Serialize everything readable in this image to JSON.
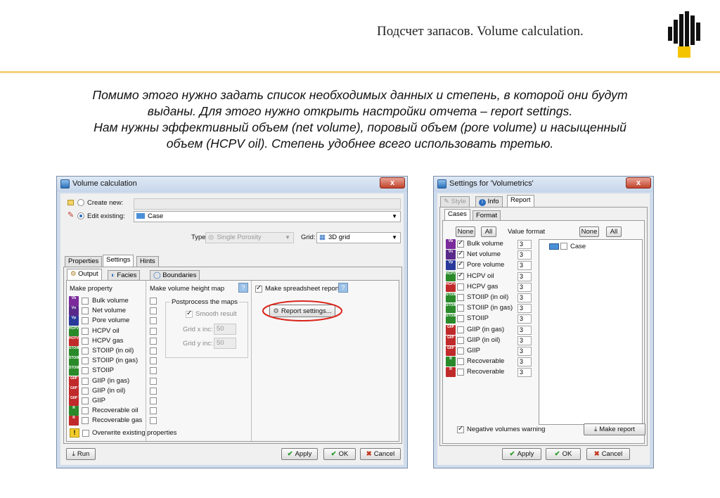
{
  "slide": {
    "title": "Подсчет запасов. Volume calculation.",
    "description_lines": [
      "Помимо этого нужно задать список необходимых данных и степень, в которой они будут",
      "выданы. Для этого нужно открыть настройки отчета – report settings.",
      "Нам нужны эффективный объем (net volume), поровый объем (pore volume) и насыщенный",
      "объем (HCPV oil). Степень удобнее всего использовать третью."
    ]
  },
  "left_window": {
    "title": "Volume calculation",
    "close": "x",
    "create_new_label": "Create new:",
    "edit_existing_label": "Edit existing:",
    "edit_existing_value": "Case",
    "type_label": "Type:",
    "type_value": "Single Porosity",
    "grid_label": "Grid:",
    "grid_value": "3D grid",
    "tabs": [
      "Properties",
      "Settings",
      "Hints"
    ],
    "subtabs": [
      "Output",
      "Facies",
      "Boundaries"
    ],
    "col_make_property": "Make property",
    "col_height_map": "Make volume height map",
    "col_spreadsheet": "Make spreadsheet report",
    "postprocess_title": "Postprocess the maps",
    "smooth_label": "Smooth result",
    "grid_x_label": "Grid x inc:",
    "grid_x_value": "50",
    "grid_y_label": "Grid y inc:",
    "grid_y_value": "50",
    "report_settings_button": "Report settings...",
    "help_icon": "?",
    "properties": [
      {
        "icon": "Vb",
        "label": "Bulk volume",
        "color": "#7a2a9a"
      },
      {
        "icon": "Vn",
        "label": "Net volume",
        "color": "#5a2a8a"
      },
      {
        "icon": "Vp",
        "label": "Pore volume",
        "color": "#2a3a9a"
      },
      {
        "icon": "HCPV",
        "label": "HCPV oil",
        "color": "#2a8a2a"
      },
      {
        "icon": "HCPV",
        "label": "HCPV gas",
        "color": "#c02a2a"
      },
      {
        "icon": "STOIIP",
        "label": "STOIIP (in oil)",
        "color": "#2a8a2a"
      },
      {
        "icon": "STOIIP",
        "label": "STOIIP (in gas)",
        "color": "#2a8a2a"
      },
      {
        "icon": "STOIIP",
        "label": "STOIIP",
        "color": "#2a8a2a"
      },
      {
        "icon": "GIIP",
        "label": "GIIP (in gas)",
        "color": "#c02a2a"
      },
      {
        "icon": "GIIP",
        "label": "GIIP (in oil)",
        "color": "#c02a2a"
      },
      {
        "icon": "GIIP",
        "label": "GIIP",
        "color": "#c02a2a"
      },
      {
        "icon": "R",
        "label": "Recoverable oil",
        "color": "#2a8a2a"
      },
      {
        "icon": "R",
        "label": "Recoverable gas",
        "color": "#c02a2a"
      }
    ],
    "overwrite_label": "Overwrite existing properties",
    "run_button": "Run",
    "apply_button": "Apply",
    "ok_button": "OK",
    "cancel_button": "Cancel"
  },
  "right_window": {
    "title": "Settings for 'Volumetrics'",
    "close": "x",
    "top_tabs": [
      "Style",
      "Info",
      "Report"
    ],
    "sub_tabs": [
      "Cases",
      "Format"
    ],
    "none_button": "None",
    "all_button": "All",
    "value_format_label": "Value format",
    "case_label": "Case",
    "items": [
      {
        "icon": "Vb",
        "label": "Bulk volume",
        "checked": true,
        "format": "3",
        "color": "#7a2a9a"
      },
      {
        "icon": "Vn",
        "label": "Net volume",
        "checked": true,
        "format": "3",
        "color": "#5a2a8a"
      },
      {
        "icon": "Vp",
        "label": "Pore volume",
        "checked": true,
        "format": "3",
        "color": "#2a3a9a"
      },
      {
        "icon": "HCPV",
        "label": "HCPV oil",
        "checked": true,
        "format": "3",
        "color": "#2a8a2a"
      },
      {
        "icon": "HCPV",
        "label": "HCPV gas",
        "checked": false,
        "format": "3",
        "color": "#c02a2a"
      },
      {
        "icon": "STOIIP",
        "label": "STOIIP (in oil)",
        "checked": false,
        "format": "3",
        "color": "#2a8a2a"
      },
      {
        "icon": "STOIIP",
        "label": "STOIIP (in gas)",
        "checked": false,
        "format": "3",
        "color": "#2a8a2a"
      },
      {
        "icon": "STOIIP",
        "label": "STOIIP",
        "checked": false,
        "format": "3",
        "color": "#2a8a2a"
      },
      {
        "icon": "GIIP",
        "label": "GIIP (in gas)",
        "checked": false,
        "format": "3",
        "color": "#c02a2a"
      },
      {
        "icon": "GIIP",
        "label": "GIIP (in oil)",
        "checked": false,
        "format": "3",
        "color": "#c02a2a"
      },
      {
        "icon": "GIIP",
        "label": "GIIP",
        "checked": false,
        "format": "3",
        "color": "#c02a2a"
      },
      {
        "icon": "R",
        "label": "Recoverable",
        "checked": false,
        "format": "3",
        "color": "#2a8a2a"
      },
      {
        "icon": "R",
        "label": "Recoverable",
        "checked": false,
        "format": "3",
        "color": "#c02a2a"
      }
    ],
    "negative_warning_label": "Negative volumes warning",
    "make_report_button": "Make report",
    "apply_button": "Apply",
    "ok_button": "OK",
    "cancel_button": "Cancel"
  },
  "colors": {
    "accent_line": "#f2d27a",
    "highlight_ellipse": "#d9261c",
    "logo_yellow": "#f5c400",
    "logo_black": "#111111"
  }
}
